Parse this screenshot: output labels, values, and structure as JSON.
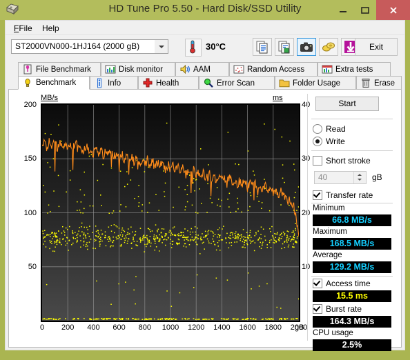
{
  "window": {
    "title": "HD Tune Pro 5.50 - Hard Disk/SSD Utility",
    "icon": "hard-disk-icon",
    "minimize": "minimize-icon",
    "maximize": "maximize-icon",
    "close": "close-icon",
    "titlebar_color": "#b3bd5c",
    "close_color": "#c75b5b"
  },
  "menu": {
    "items": [
      {
        "label": "File",
        "mnemonic": "F"
      },
      {
        "label": "Help",
        "mnemonic": "H"
      }
    ]
  },
  "toolbar": {
    "drive_select": {
      "value": "ST2000VN000-1HJ164 (2000 gB)",
      "icon": "chevron-down-icon"
    },
    "temperature": {
      "icon": "thermometer-icon",
      "value": "30°C"
    },
    "buttons": [
      {
        "name": "copy-icon",
        "selected": false
      },
      {
        "name": "copy-image-icon",
        "selected": false
      },
      {
        "name": "camera-icon",
        "selected": true
      },
      {
        "name": "coins-icon",
        "selected": false
      },
      {
        "name": "download-arrow-icon",
        "selected": false
      }
    ],
    "exit_label": "Exit"
  },
  "tabs": {
    "row1": [
      {
        "label": "File Benchmark",
        "icon": "file-benchmark-icon",
        "active": false
      },
      {
        "label": "Disk monitor",
        "icon": "bar-chart-icon",
        "active": false
      },
      {
        "label": "AAM",
        "icon": "speaker-icon",
        "active": false
      },
      {
        "label": "Random Access",
        "icon": "scatter-icon",
        "active": false
      },
      {
        "label": "Extra tests",
        "icon": "extra-tests-icon",
        "active": false
      }
    ],
    "row2": [
      {
        "label": "Benchmark",
        "icon": "lightbulb-icon",
        "active": true
      },
      {
        "label": "Info",
        "icon": "info-icon",
        "active": false
      },
      {
        "label": "Health",
        "icon": "health-cross-icon",
        "active": false
      },
      {
        "label": "Error Scan",
        "icon": "magnifier-icon",
        "active": false
      },
      {
        "label": "Folder Usage",
        "icon": "folder-icon",
        "active": false
      },
      {
        "label": "Erase",
        "icon": "trash-icon",
        "active": false
      }
    ]
  },
  "panel": {
    "start_label": "Start",
    "mode": {
      "read_label": "Read",
      "write_label": "Write",
      "selected": "Write"
    },
    "short_stroke": {
      "label": "Short stroke",
      "checked": false,
      "value": "40",
      "unit": "gB"
    },
    "transfer_rate": {
      "label": "Transfer rate",
      "checked": true,
      "minimum_label": "Minimum",
      "minimum_value": "66.8 MB/s",
      "maximum_label": "Maximum",
      "maximum_value": "168.5 MB/s",
      "average_label": "Average",
      "average_value": "129.2 MB/s"
    },
    "access_time": {
      "label": "Access time",
      "checked": true,
      "value": "15.5 ms"
    },
    "burst_rate": {
      "label": "Burst rate",
      "checked": true,
      "value": "164.3 MB/s"
    },
    "cpu_usage": {
      "label": "CPU usage",
      "value": "2.5%"
    },
    "colors": {
      "readout_bg": "#000000",
      "readout_cyan": "#14cfff",
      "readout_yellow": "#ffff00",
      "readout_white": "#ffffff"
    }
  },
  "chart_data": {
    "type": "line",
    "title": "",
    "xlabel": "gB",
    "ylabel": "MB/s",
    "y2label": "ms",
    "xlim": [
      0,
      2000
    ],
    "ylim": [
      0,
      200
    ],
    "y2lim": [
      0,
      40
    ],
    "grid": true,
    "legend": "none",
    "xticks": [
      0,
      200,
      400,
      600,
      800,
      1000,
      1200,
      1400,
      1600,
      1800,
      2000
    ],
    "yticks": [
      50,
      100,
      150,
      200
    ],
    "y2ticks": [
      10,
      20,
      30,
      40
    ],
    "background": "#111111",
    "series": [
      {
        "name": "Transfer rate",
        "color": "#ff8c1a",
        "axis": "left",
        "unit": "MB/s",
        "x": [
          0,
          20,
          40,
          60,
          80,
          100,
          120,
          140,
          160,
          180,
          200,
          220,
          240,
          260,
          280,
          300,
          320,
          340,
          360,
          380,
          400,
          420,
          440,
          460,
          480,
          500,
          520,
          540,
          560,
          580,
          600,
          620,
          640,
          660,
          680,
          700,
          720,
          740,
          760,
          780,
          800,
          820,
          840,
          860,
          880,
          900,
          920,
          940,
          960,
          980,
          1000,
          1020,
          1040,
          1060,
          1080,
          1100,
          1120,
          1140,
          1160,
          1180,
          1200,
          1220,
          1240,
          1260,
          1280,
          1300,
          1320,
          1340,
          1360,
          1380,
          1400,
          1420,
          1440,
          1460,
          1480,
          1500,
          1520,
          1540,
          1560,
          1580,
          1600,
          1620,
          1640,
          1660,
          1680,
          1700,
          1720,
          1740,
          1760,
          1780,
          1800,
          1820,
          1840,
          1860,
          1880,
          1900,
          1920,
          1940,
          1960,
          1980,
          2000
        ],
        "y": [
          162,
          166,
          158,
          167,
          160,
          165,
          159,
          166,
          161,
          164,
          158,
          166,
          160,
          165,
          159,
          163,
          156,
          162,
          157,
          161,
          154,
          160,
          155,
          159,
          152,
          158,
          153,
          157,
          150,
          156,
          151,
          155,
          148,
          153,
          149,
          152,
          146,
          151,
          147,
          150,
          144,
          149,
          145,
          148,
          142,
          147,
          143,
          146,
          140,
          145,
          141,
          144,
          138,
          143,
          139,
          142,
          136,
          141,
          137,
          140,
          133,
          138,
          134,
          137,
          131,
          136,
          132,
          135,
          129,
          134,
          130,
          133,
          127,
          132,
          128,
          131,
          125,
          130,
          126,
          129,
          123,
          128,
          124,
          126,
          120,
          125,
          121,
          124,
          117,
          122,
          118,
          121,
          114,
          119,
          115,
          117,
          110,
          112,
          105,
          95,
          78
        ],
        "minimum": 66.8,
        "maximum": 168.5,
        "average": 129.2
      },
      {
        "name": "Access time",
        "color": "#ffff00",
        "axis": "right",
        "unit": "ms",
        "marker": "dot",
        "mean": 15.5,
        "spread": [
          12,
          20
        ],
        "note": "scattered dots clustering around 14-17 ms with outliers from 0.5 to 40 ms"
      }
    ]
  }
}
